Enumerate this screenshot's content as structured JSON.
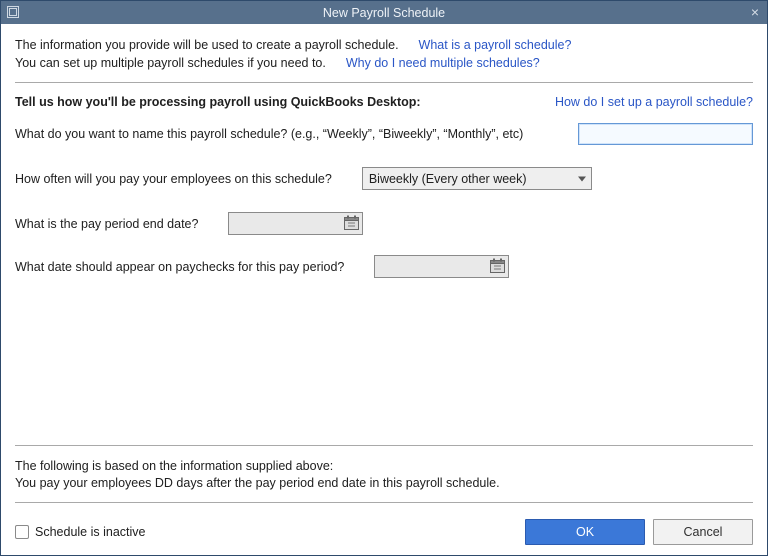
{
  "window": {
    "title": "New Payroll Schedule"
  },
  "intro": {
    "line1": "The information you provide will be used to create a payroll schedule.",
    "link1": "What is a payroll schedule?",
    "line2": "You can set up multiple payroll schedules if you need to.",
    "link2": "Why do I need multiple schedules?"
  },
  "section": {
    "heading": "Tell us how you'll be processing payroll using QuickBooks Desktop:",
    "help_link": "How do I set up a payroll schedule?"
  },
  "fields": {
    "name_label": "What do you want to name this payroll schedule? (e.g., “Weekly”, “Biweekly”, “Monthly”, etc)",
    "name_value": "",
    "frequency_label": "How often will you pay your employees on this schedule?",
    "frequency_value": "Biweekly (Every other week)",
    "period_end_label": "What is the pay period end date?",
    "period_end_value": "",
    "paycheck_date_label": "What date should appear on paychecks for this pay period?",
    "paycheck_date_value": ""
  },
  "summary": {
    "line1": "The following is based on the information supplied above:",
    "line2": "You pay your employees DD days after the pay period end date in this payroll schedule."
  },
  "footer": {
    "inactive_label": "Schedule is inactive",
    "inactive_checked": false,
    "ok": "OK",
    "cancel": "Cancel"
  }
}
